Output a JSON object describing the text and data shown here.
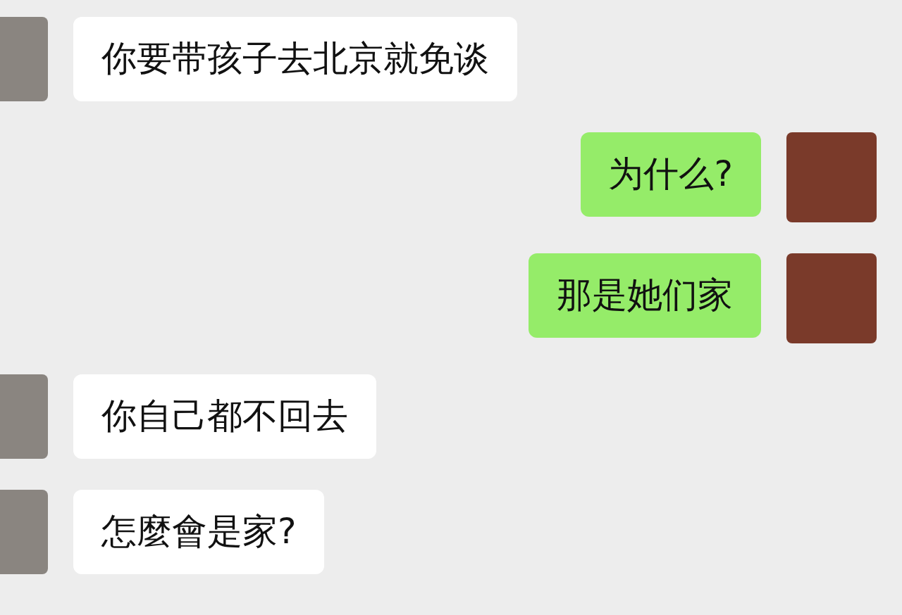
{
  "messages": [
    {
      "kind": "received",
      "text": "你要带孩子去北京就免谈"
    },
    {
      "kind": "sent",
      "text": "为什么?"
    },
    {
      "kind": "sent",
      "text": "那是她们家"
    },
    {
      "kind": "received",
      "text": "你自己都不回去"
    },
    {
      "kind": "received",
      "text": "怎麼會是家?"
    }
  ]
}
